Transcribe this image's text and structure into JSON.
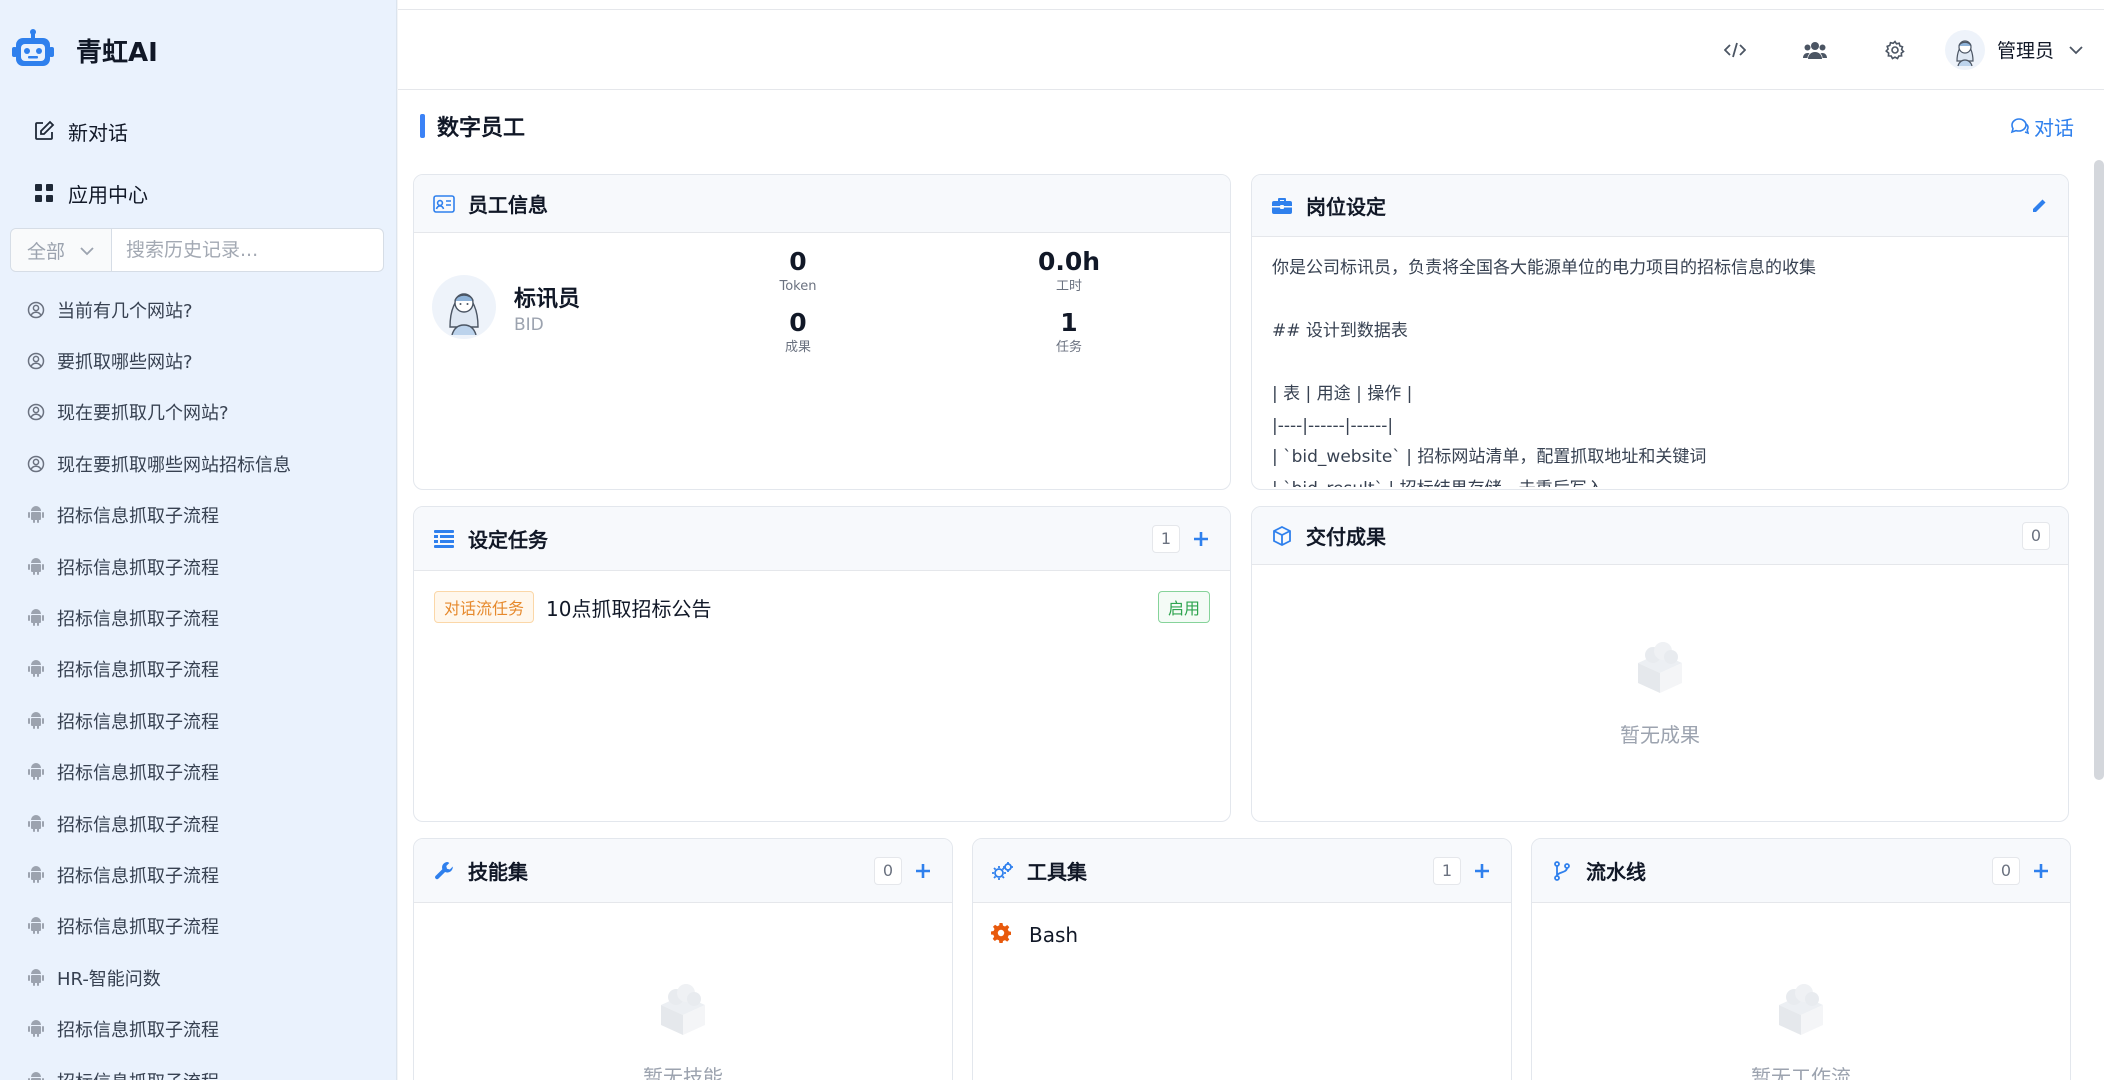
{
  "app": {
    "name": "青虹AI"
  },
  "sidebar": {
    "actions": [
      {
        "label": "新对话",
        "icon": "edit-icon"
      },
      {
        "label": "应用中心",
        "icon": "grid-icon"
      }
    ],
    "filter": {
      "value": "全部"
    },
    "search": {
      "placeholder": "搜索历史记录..."
    },
    "history": [
      {
        "label": "当前有几个网站?",
        "icon": "user-circle-icon"
      },
      {
        "label": "要抓取哪些网站?",
        "icon": "user-circle-icon"
      },
      {
        "label": "现在要抓取几个网站?",
        "icon": "user-circle-icon"
      },
      {
        "label": "现在要抓取哪些网站招标信息",
        "icon": "user-circle-icon"
      },
      {
        "label": "招标信息抓取子流程",
        "icon": "android-icon"
      },
      {
        "label": "招标信息抓取子流程",
        "icon": "android-icon"
      },
      {
        "label": "招标信息抓取子流程",
        "icon": "android-icon"
      },
      {
        "label": "招标信息抓取子流程",
        "icon": "android-icon"
      },
      {
        "label": "招标信息抓取子流程",
        "icon": "android-icon"
      },
      {
        "label": "招标信息抓取子流程",
        "icon": "android-icon"
      },
      {
        "label": "招标信息抓取子流程",
        "icon": "android-icon"
      },
      {
        "label": "招标信息抓取子流程",
        "icon": "android-icon"
      },
      {
        "label": "招标信息抓取子流程",
        "icon": "android-icon"
      },
      {
        "label": "HR-智能问数",
        "icon": "android-icon"
      },
      {
        "label": "招标信息抓取子流程",
        "icon": "android-icon"
      },
      {
        "label": "招标信息抓取子流程",
        "icon": "android-icon"
      }
    ]
  },
  "header": {
    "user_name": "管理员"
  },
  "page": {
    "title": "数字员工",
    "chat_label": "对话"
  },
  "employee": {
    "title": "员工信息",
    "name": "标讯员",
    "code": "BID",
    "stats": [
      {
        "value": "0",
        "label": "Token"
      },
      {
        "value": "0.0h",
        "label": "工时"
      },
      {
        "value": "0",
        "label": "成果"
      },
      {
        "value": "1",
        "label": "任务"
      }
    ]
  },
  "role": {
    "title": "岗位设定",
    "lines": [
      "你是公司标讯员，负责将全国各大能源单位的电力项目的招标信息的收集",
      "",
      "## 设计到数据表",
      "",
      "| 表 | 用途 | 操作 |",
      "|----|------|------|",
      "| `bid_website` | 招标网站清单，配置抓取地址和关键词",
      "| `bid_result` | 招标结果存储，去重后写入"
    ]
  },
  "tasks": {
    "title": "设定任务",
    "count": "1",
    "items": [
      {
        "type": "对话流任务",
        "name": "10点抓取招标公告",
        "status": "启用"
      }
    ]
  },
  "deliverables": {
    "title": "交付成果",
    "count": "0",
    "empty": "暂无成果"
  },
  "skills": {
    "title": "技能集",
    "count": "0",
    "empty": "暂无技能"
  },
  "tools": {
    "title": "工具集",
    "count": "1",
    "items": [
      {
        "name": "Bash"
      }
    ]
  },
  "pipelines": {
    "title": "流水线",
    "count": "0",
    "empty": "暂无工作流"
  },
  "colors": {
    "accent": "#2f80ed",
    "sidebar_bg": "#eaf2fd",
    "tag_orange": "#e6892c",
    "tag_green": "#2ea44f"
  }
}
